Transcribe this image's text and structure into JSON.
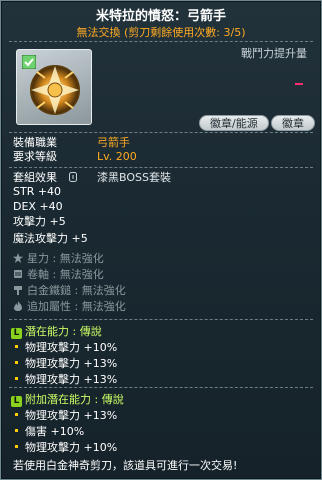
{
  "header": {
    "title": "米特拉的憤怒：弓箭手",
    "subtitle": "無法交換 (剪刀剩餘使用次數: 3/5)"
  },
  "top_right": {
    "label": "戰鬥力提升量"
  },
  "buttons": {
    "emblem_source": "徽章/能源",
    "emblem": "徽章"
  },
  "requirements": {
    "job_label": "裝備職業",
    "job_value": "弓箭手",
    "level_label": "要求等級",
    "level_value": "Lv. 200"
  },
  "set_effect": {
    "label": "套組效果",
    "name": "漆黑BOSS套裝"
  },
  "stats": {
    "str": "STR  +40",
    "dex": "DEX  +40",
    "attack": "攻擊力  +5",
    "magic_attack": "魔法攻擊力  +5"
  },
  "disabled_upgrades": [
    {
      "icon": "star-icon",
      "text": "星力 : 無法強化"
    },
    {
      "icon": "scroll-icon",
      "text": "卷軸 : 無法強化"
    },
    {
      "icon": "hammer-icon",
      "text": "白金鐵鎚 : 無法強化"
    },
    {
      "icon": "flame-icon",
      "text": "追加屬性 : 無法強化"
    }
  ],
  "potential": {
    "header": "潛在能力 : 傳說",
    "grade_letter": "L",
    "lines": [
      "物理攻擊力 +10%",
      "物理攻擊力 +13%",
      "物理攻擊力 +13%"
    ]
  },
  "additional_potential": {
    "header": "附加潛在能力 : 傳說",
    "grade_letter": "L",
    "lines": [
      "物理攻擊力 +13%",
      "傷害 +10%",
      "物理攻擊力 +10%"
    ]
  },
  "footer": "若使用白金神奇剪刀，該道具可進行一次交易!",
  "colors": {
    "gold": "#ffaa22",
    "legend_green": "#ccff66",
    "legend_badge": "#8bd21f",
    "disabled_gray": "#8a979c",
    "accent_pink": "#ff2f6e"
  }
}
